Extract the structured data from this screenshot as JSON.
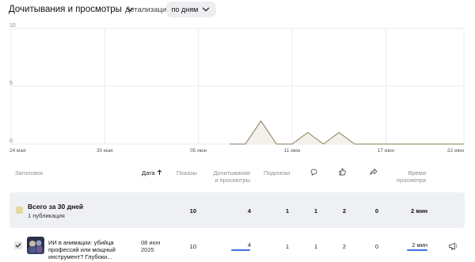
{
  "header": {
    "metric_label": "Дочитывания и просмотры",
    "detail_label": "Детализация",
    "period_label": "по дням"
  },
  "chart_data": {
    "type": "area",
    "title": "",
    "xlabel": "",
    "ylabel": "",
    "x": [
      "24 мая",
      "25 мая",
      "26 мая",
      "27 мая",
      "28 мая",
      "29 мая",
      "30 мая",
      "31 мая",
      "01 июн",
      "02 июн",
      "03 июн",
      "04 июн",
      "05 июн",
      "06 июн",
      "07 июн",
      "08 июн",
      "09 июн",
      "10 июн",
      "11 июн",
      "12 июн",
      "13 июн",
      "14 июн",
      "15 июн",
      "16 июн",
      "17 июн",
      "18 июн",
      "19 июн",
      "20 июн",
      "21 июн",
      "22 июн"
    ],
    "values": [
      null,
      null,
      null,
      null,
      null,
      null,
      null,
      null,
      null,
      null,
      null,
      null,
      null,
      null,
      0,
      0,
      2,
      0,
      0,
      1,
      0,
      1,
      0,
      0,
      0,
      0,
      0,
      0,
      0,
      0
    ],
    "ylim": [
      0,
      10
    ],
    "yticks": [
      "0",
      "5",
      "10"
    ],
    "xticks": [
      "24 мая",
      "30 мая",
      "05 июн",
      "11 июн",
      "17 июн",
      "22 июн"
    ],
    "grid": true,
    "line_color": "#8a7a5a",
    "fill_color": "#f3f1ec"
  },
  "table": {
    "headers": {
      "title": "Заголовок",
      "date": "Дата",
      "shows": "Показы",
      "reads_line1": "Дочитывания",
      "reads_line2": "и просмотры",
      "subs": "Подписки",
      "time_line1": "Время",
      "time_line2": "просмотра"
    },
    "total": {
      "title": "Всего за 30 дней",
      "subtitle": "1 публикация",
      "shows": "10",
      "reads": "4",
      "subs": "1",
      "comments": "1",
      "likes": "2",
      "shares": "0",
      "time": "2 мин"
    },
    "rows": [
      {
        "title": "ИИ в анимации: убийца профессий или мощный инструмент? Глубоки...",
        "date_line1": "08 июн",
        "date_line2": "2025",
        "shows": "10",
        "reads": "4",
        "reads_fraction": 0.4,
        "subs": "1",
        "comments": "1",
        "likes": "2",
        "shares": "0",
        "time": "2 мин",
        "time_fraction": 1.0
      }
    ]
  },
  "colors": {
    "accent": "#3b6ee0",
    "total_bg": "#eef0f3",
    "total_icon": "#e3d9a3"
  },
  "icons": {
    "sort": "arrow-up-icon",
    "comments": "comment-icon",
    "likes": "thumbs-up-icon",
    "shares": "share-icon",
    "promo": "megaphone-icon"
  }
}
